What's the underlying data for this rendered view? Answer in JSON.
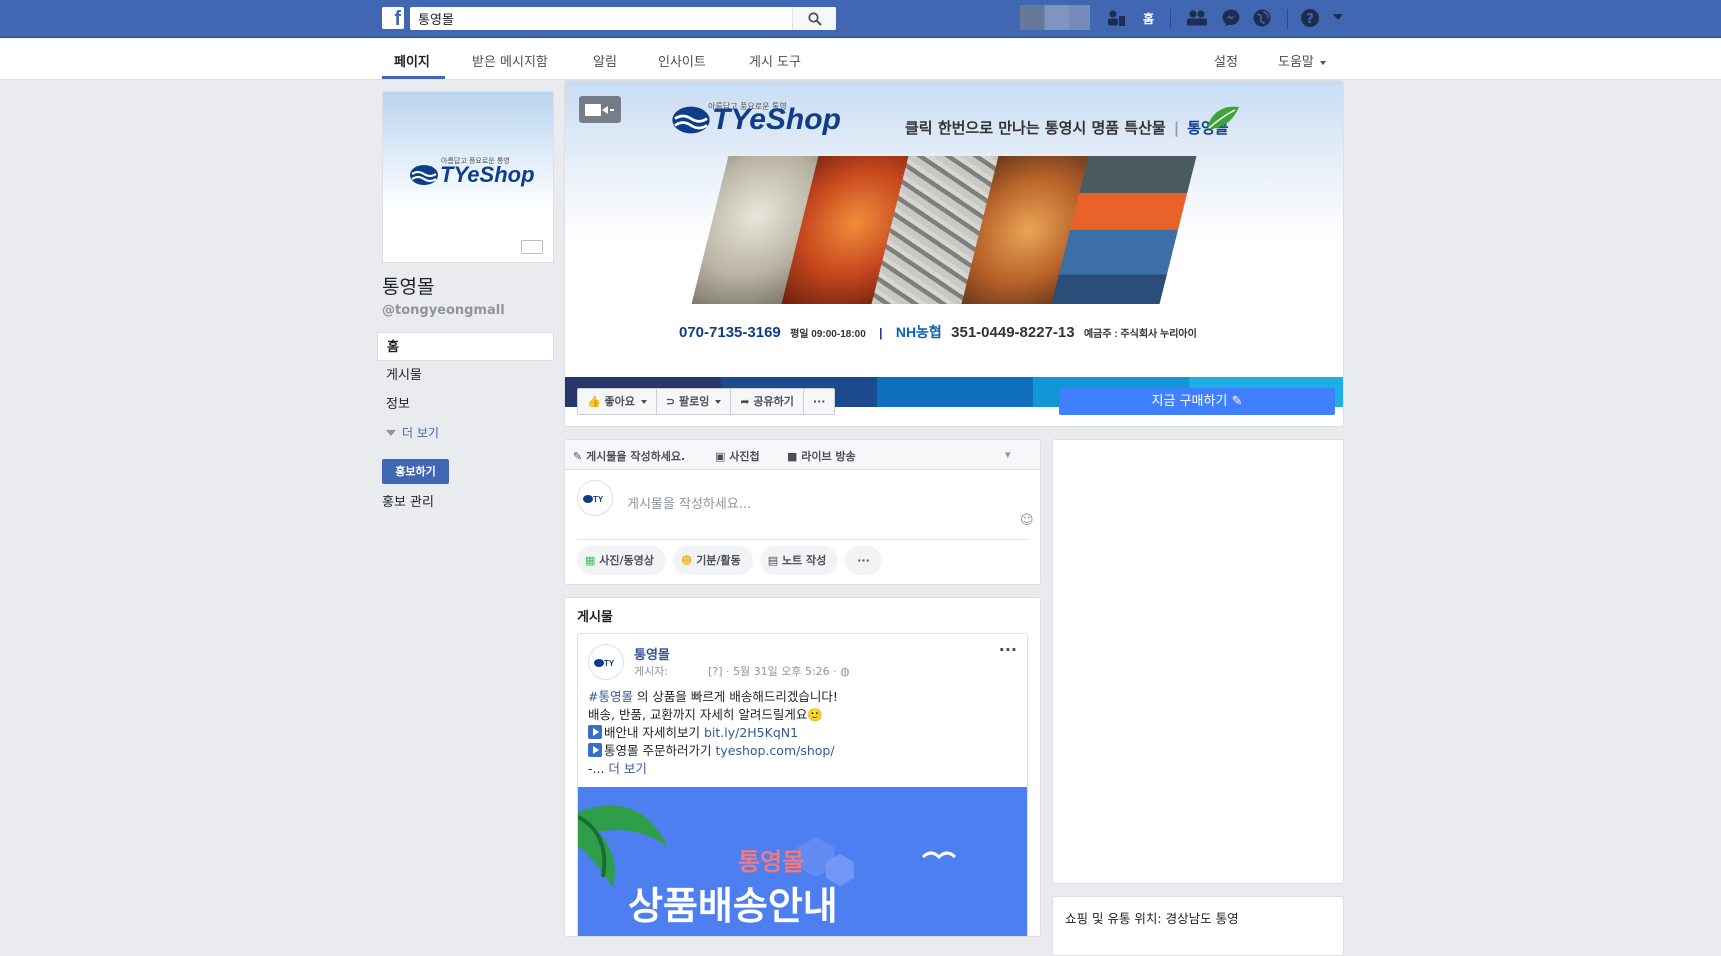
{
  "topbar": {
    "logo_letter": "f",
    "search_value": "통영몰",
    "home_label": "홈"
  },
  "subnav": {
    "tabs": [
      {
        "label": "페이지"
      },
      {
        "label": "받은 메시지함"
      },
      {
        "label": "알림"
      },
      {
        "label": "인사이트"
      },
      {
        "label": "게시 도구"
      }
    ],
    "settings": "설정",
    "help": "도움말"
  },
  "profile": {
    "logo_text": "TYeShop",
    "logo_tagline": "아름답고 풍요로운 통영",
    "name": "통영몰",
    "handle": "@tongyeongmall"
  },
  "leftnav": {
    "items": [
      {
        "label": "홈"
      },
      {
        "label": "게시물"
      },
      {
        "label": "정보"
      }
    ],
    "more": "더 보기",
    "promote": "홍보하기",
    "promote_manage": "홍보 관리"
  },
  "cover": {
    "logo_text": "TYeShop",
    "logo_tagline": "아름답고 풍요로운 통영",
    "tagline": "클릭 한번으로 만나는 통영시 명품 특산물",
    "tagline_brand": "통영몰",
    "phone": "070-7135-3169",
    "hours": "평일 09:00-18:00",
    "bank": "NH농협",
    "account": "351-0449-8227-13",
    "holder": "예금주 : 주식회사 누리아이",
    "stripe_colors": [
      "#27376e",
      "#1a4b8e",
      "#0d6fbd",
      "#1196d6",
      "#1eaee4"
    ]
  },
  "actions": {
    "like": "좋아요",
    "follow": "팔로잉",
    "share": "공유하기",
    "more": "···",
    "buy": "지금 구매하기"
  },
  "composer": {
    "tabs": [
      {
        "label": "게시물을 작성하세요."
      },
      {
        "label": "사진첩"
      },
      {
        "label": "라이브 방송"
      }
    ],
    "placeholder": "게시물을 작성하세요...",
    "chips": [
      {
        "label": "사진/동영상"
      },
      {
        "label": "기분/활동"
      },
      {
        "label": "노트 작성"
      },
      {
        "label": "···"
      }
    ]
  },
  "feed": {
    "title": "게시물",
    "post": {
      "author": "통영몰",
      "posted_by": "게시자:",
      "timestamp": "[?] · 5월 31일 오후 5:26 ·",
      "hashtag": "#통영몰",
      "line1_rest": " 의 상품을 빠르게 배송해드리겠습니다!",
      "line2": "배송, 반품, 교환까지 자세히 알려드릴게요🙂",
      "line3_text": "배안내 자세히보기 ",
      "line3_link": "bit.ly/2H5KqN1",
      "line4_text": "통영몰 주문하러가기 ",
      "line4_link": "tyeshop.com/shop/",
      "line5_prefix": "-...",
      "more": "더 보기",
      "image_title": "통영몰",
      "image_subtitle": "상품배송안내"
    }
  },
  "sidebar": {
    "location": "쇼핑 및 유통 위치: 경상남도 통영"
  }
}
